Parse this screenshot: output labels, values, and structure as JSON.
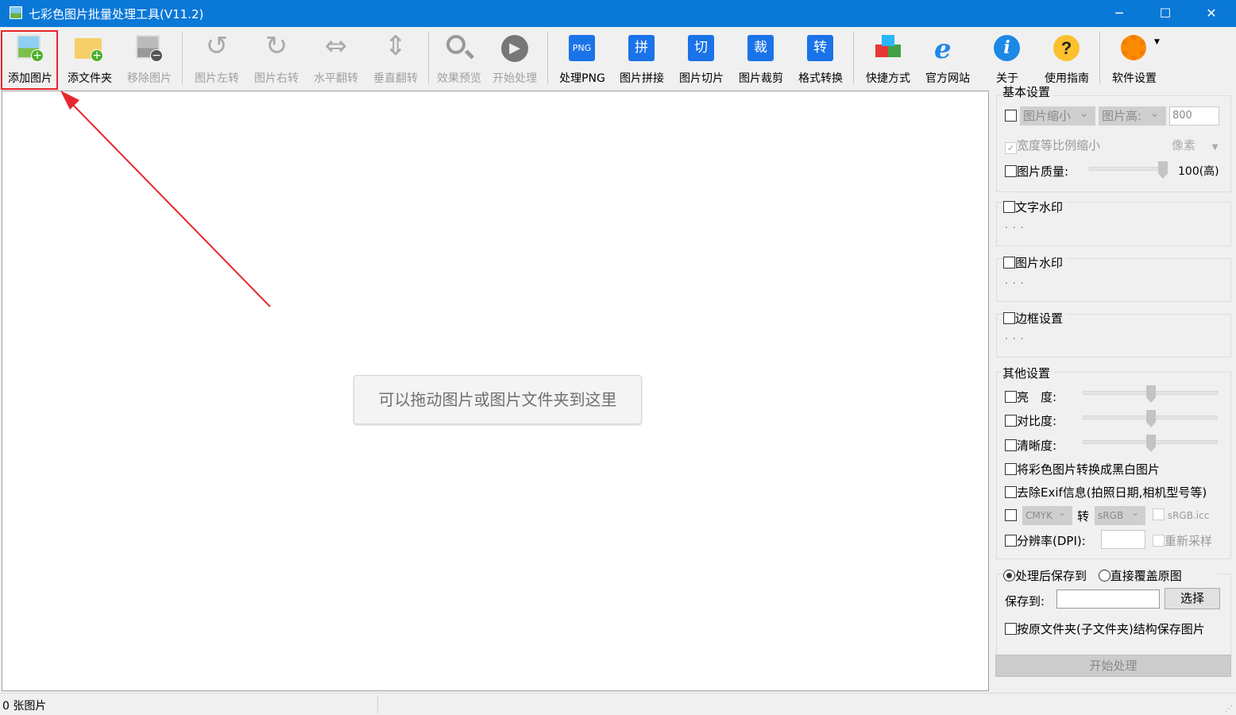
{
  "window": {
    "title": "七彩色图片批量处理工具(V11.2)",
    "minimize": "─",
    "maximize": "☐",
    "close": "✕"
  },
  "toolbar": [
    {
      "id": "add-image",
      "label": "添加图片",
      "icon": "add-image-icon",
      "enabled": true
    },
    {
      "id": "add-folder",
      "label": "添文件夹",
      "icon": "add-folder-icon",
      "enabled": true
    },
    {
      "id": "remove-image",
      "label": "移除图片",
      "icon": "remove-image-icon",
      "enabled": false
    },
    {
      "id": "rotate-left",
      "label": "图片左转",
      "icon": "rotate-left-icon",
      "enabled": false
    },
    {
      "id": "rotate-right",
      "label": "图片右转",
      "icon": "rotate-right-icon",
      "enabled": false
    },
    {
      "id": "flip-horizontal",
      "label": "水平翻转",
      "icon": "flip-horizontal-icon",
      "enabled": false
    },
    {
      "id": "flip-vertical",
      "label": "垂直翻转",
      "icon": "flip-vertical-icon",
      "enabled": false
    },
    {
      "id": "preview",
      "label": "效果预览",
      "icon": "magnifier-icon",
      "enabled": false
    },
    {
      "id": "start",
      "label": "开始处理",
      "icon": "play-icon",
      "enabled": false
    },
    {
      "id": "process-png",
      "label": "处理PNG",
      "icon": "png-icon",
      "glyph": "PNG",
      "enabled": true
    },
    {
      "id": "stitch",
      "label": "图片拼接",
      "icon": "stitch-icon",
      "glyph": "拼",
      "enabled": true
    },
    {
      "id": "slice",
      "label": "图片切片",
      "icon": "slice-icon",
      "glyph": "切",
      "enabled": true
    },
    {
      "id": "crop",
      "label": "图片裁剪",
      "icon": "crop-icon",
      "glyph": "裁",
      "enabled": true
    },
    {
      "id": "convert",
      "label": "格式转换",
      "icon": "convert-icon",
      "glyph": "转",
      "enabled": true
    },
    {
      "id": "shortcut",
      "label": "快捷方式",
      "icon": "cubes-icon",
      "enabled": true
    },
    {
      "id": "website",
      "label": "官方网站",
      "icon": "ie-icon",
      "glyph": "e",
      "enabled": true
    },
    {
      "id": "about",
      "label": "关于",
      "icon": "info-icon",
      "glyph": "i",
      "enabled": true
    },
    {
      "id": "help",
      "label": "使用指南",
      "icon": "help-icon",
      "glyph": "?",
      "enabled": true
    },
    {
      "id": "settings",
      "label": "软件设置",
      "icon": "gear-icon",
      "enabled": true
    }
  ],
  "main": {
    "drop_hint": "可以拖动图片或图片文件夹到这里"
  },
  "panel": {
    "basic": {
      "title": "基本设置",
      "resize_mode": "图片缩小",
      "dimension": "图片高:",
      "size_value": "800",
      "keep_ratio": "宽度等比例缩小",
      "unit": "像素",
      "quality_label": "图片质量:",
      "quality_value": "100(高)",
      "quality": 100
    },
    "text_watermark": {
      "title": "文字水印",
      "dots": "..."
    },
    "image_watermark": {
      "title": "图片水印",
      "dots": "..."
    },
    "border": {
      "title": "边框设置",
      "dots": "..."
    },
    "other": {
      "title": "其他设置",
      "brightness": "亮　度:",
      "contrast": "对比度:",
      "sharpness": "清晰度:",
      "grayscale": "将彩色图片转换成黑白图片",
      "remove_exif": "去除Exif信息(拍照日期,相机型号等)",
      "color_from": "CMYK",
      "convert_word": "转",
      "color_to": "sRGB",
      "icc": "sRGB.icc",
      "dpi_label": "分辨率(DPI):",
      "resample": "重新采样"
    },
    "save": {
      "option_save_to": "处理后保存到",
      "option_overwrite": "直接覆盖原图",
      "save_to_label": "保存到:",
      "choose": "选择",
      "keep_structure": "按原文件夹(子文件夹)结构保存图片"
    },
    "start": "开始处理"
  },
  "status": {
    "count": "0 张图片"
  }
}
